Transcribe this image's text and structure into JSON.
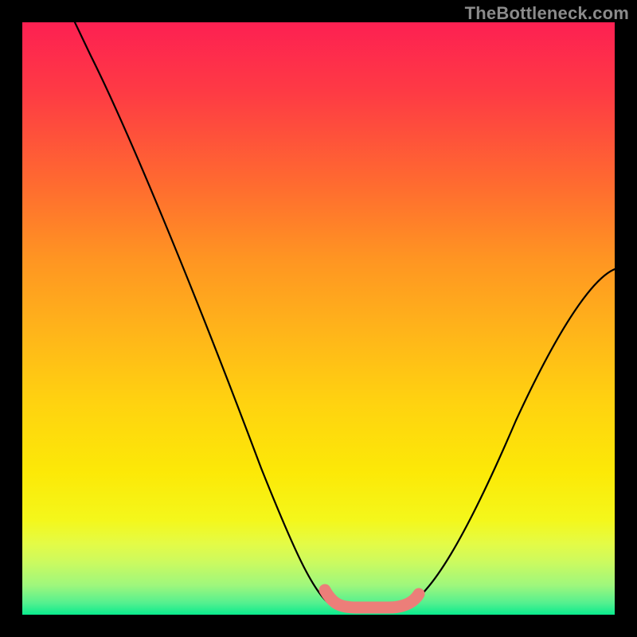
{
  "watermark": "TheBottleneck.com",
  "chart_data": {
    "type": "line",
    "title": "",
    "xlabel": "",
    "ylabel": "",
    "xlim": [
      0,
      100
    ],
    "ylim": [
      0,
      100
    ],
    "grid": false,
    "series": [
      {
        "name": "bottleneck-curve",
        "color": "#000000",
        "x": [
          10,
          13,
          17,
          21,
          25,
          29,
          33,
          37,
          41,
          45,
          49,
          52,
          55,
          58,
          62,
          66,
          70,
          74,
          78,
          82,
          86,
          90,
          94,
          98,
          100
        ],
        "values": [
          100,
          94,
          87,
          80,
          72,
          64,
          56,
          48,
          40,
          32,
          24,
          16,
          8,
          1.5,
          1,
          1.5,
          8,
          16,
          24,
          32,
          40,
          48,
          52,
          56,
          58
        ]
      },
      {
        "name": "optimal-range-marker",
        "color": "#ec7e79",
        "x": [
          52,
          55,
          58,
          62,
          66
        ],
        "values": [
          4.5,
          1.8,
          1.3,
          1.3,
          3.2
        ]
      }
    ],
    "annotations": []
  }
}
